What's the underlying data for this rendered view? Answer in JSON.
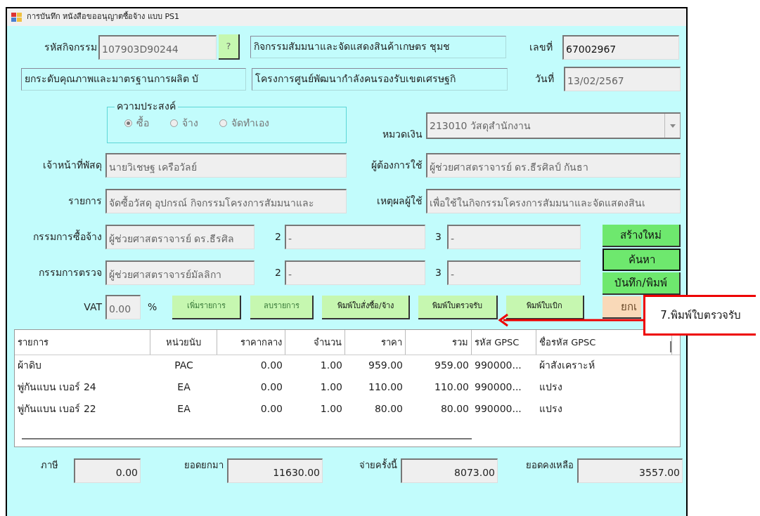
{
  "window": {
    "title": "การบันทึก หนังสือขออนุญาตซื้อจ้าง แบบ PS1"
  },
  "activity": {
    "label": "รหัสกิจกรรม",
    "code": "107903D90244",
    "lookup_button": "?",
    "name": "กิจกรรมสัมมนาและจัดแสดงสินค้าเกษตร ชุมช",
    "plan": "ยกระดับคุณภาพและมาตรฐานการผลิต บั",
    "project": "โครงการศูนย์พัฒนากำลังคนรองรับเขตเศรษฐกิ"
  },
  "doc_number": {
    "label": "เลขที่",
    "value": "67002967"
  },
  "date": {
    "label": "วันที่",
    "value": "13/02/2567"
  },
  "purpose": {
    "legend": "ความประสงค์",
    "options": [
      {
        "label": "ซื้อ",
        "selected": true
      },
      {
        "label": "จ้าง",
        "selected": false
      },
      {
        "label": "จัดทำเอง",
        "selected": false
      }
    ]
  },
  "budget_category": {
    "label": "หมวดเงิน",
    "value": "213010 วัสดุสำนักงาน"
  },
  "fields": [
    {
      "label": "เจ้าหน้าที่พัสดุ",
      "value": "นายวิเชษฐ เครือวัลย์"
    },
    {
      "label": "ผู้ต้องการใช้",
      "value": "ผู้ช่วยศาสตราจารย์ ดร.ธีรศิลป์  กันธา"
    },
    {
      "label": "รายการ",
      "value": "จัดซื้อวัสดุ อุปกรณ์ กิจกรรมโครงการสัมมนาและ"
    },
    {
      "label": "เหตุผลผู้ใช้",
      "value": "เพื่อใช้ในกิจกรรมโครงการสัมมนาและจัดแสดงสินเ"
    }
  ],
  "committees": [
    {
      "label": "กรรมการซื้อจ้าง",
      "member_1": "ผู้ช่วยศาสตราจารย์ ดร.ธีรศิล",
      "label_2": "2",
      "member_2": "-",
      "label_3": "3",
      "member_3": "-"
    },
    {
      "label": "กรรมการตรวจ",
      "member_1": "ผู้ช่วยศาสตราจารย์มัลลิกา",
      "label_2": "2",
      "member_2": "-",
      "label_3": "3",
      "member_3": "-"
    }
  ],
  "vat": {
    "label": "VAT",
    "value": "0.00",
    "unit": "%"
  },
  "item_buttons": [
    {
      "label": "เพิ่มรายการ",
      "kind": "edit"
    },
    {
      "label": "ลบรายการ",
      "kind": "edit"
    },
    {
      "label": "พิมพ์ใบสั่งซื้อ/จ้าง",
      "kind": "print"
    },
    {
      "label": "พิมพ์ใบตรวจรับ",
      "kind": "print"
    },
    {
      "label": "พิมพ์ใบเบิก",
      "kind": "print"
    }
  ],
  "side_buttons": [
    {
      "label": "สร้างใหม่",
      "kind": "action"
    },
    {
      "label": "ค้นหา",
      "kind": "focused"
    },
    {
      "label": "บันทึก/พิมพ์",
      "kind": "action"
    },
    {
      "label": "ยกเ",
      "kind": "cancel"
    }
  ],
  "table": {
    "columns": [
      "รายการ",
      "หน่วยนับ",
      "ราคากลาง",
      "จำนวน",
      "ราคา",
      "รวม",
      "รหัส GPSC",
      "ชื่อรหัส GPSC"
    ],
    "rows": [
      [
        "ผ้าดิบ",
        "PAC",
        "0.00",
        "1.00",
        "959.00",
        "959.00",
        "990000...",
        "ผ้าสังเคราะห์"
      ],
      [
        "พู่กันแบน เบอร์ 24",
        "EA",
        "0.00",
        "1.00",
        "110.00",
        "110.00",
        "990000...",
        "แปรง"
      ],
      [
        "พู่กันแบน เบอร์ 22",
        "EA",
        "0.00",
        "1.00",
        "80.00",
        "80.00",
        "990000...",
        "แปรง"
      ]
    ]
  },
  "totals": [
    {
      "label": "ภาษี",
      "value": "0.00"
    },
    {
      "label": "ยอดยกมา",
      "value": "11630.00"
    },
    {
      "label": "จ่ายครั้งนี้",
      "value": "8073.00"
    },
    {
      "label": "ยอดคงเหลือ",
      "value": "3557.00"
    }
  ],
  "callout": {
    "text": "7.พิมพ์ใบตรวจรับ"
  }
}
